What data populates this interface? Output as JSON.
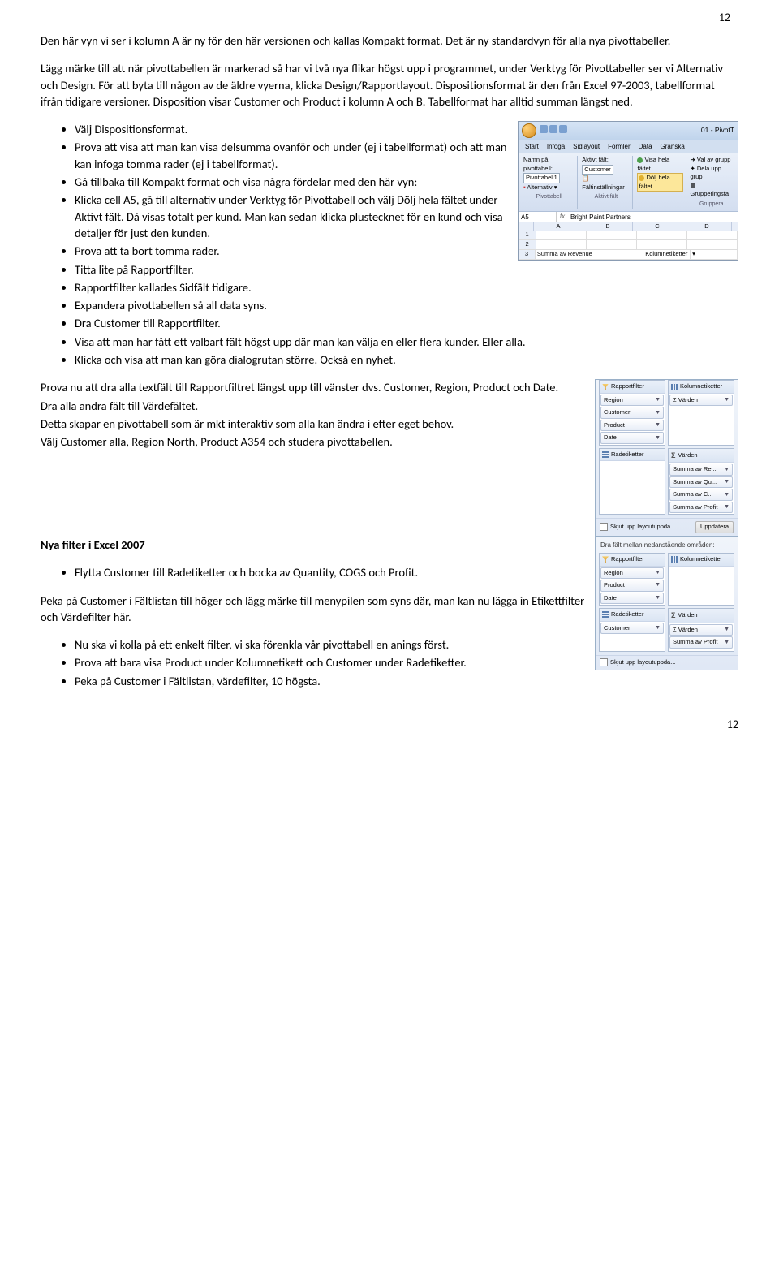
{
  "page": {
    "top": "12",
    "bottom": "12"
  },
  "para1": "Den här vyn vi ser i kolumn A är ny för den här versionen och kallas Kompakt format. Det är ny standardvyn för alla nya pivottabeller.",
  "para2": "Lägg märke till att när pivottabellen är markerad så har vi två nya flikar högst upp i programmet, under Verktyg för Pivottabeller ser vi Alternativ och Design. För att byta till någon av de äldre vyerna, klicka Design/Rapportlayout. Dispositionsformat är den från Excel 97-2003, tabellformat ifrån tidigare versioner. Disposition visar Customer och Product i kolumn A och B. Tabellformat har alltid summan längst ned.",
  "bullets1": {
    "i0": "Välj Dispositionsformat.",
    "i1": "Prova att visa att man kan visa delsumma ovanför och under (ej i tabellformat) och att man kan infoga tomma rader (ej i tabellformat).",
    "i2": "Gå tillbaka till Kompakt format och visa några fördelar med den här vyn:",
    "i3": "Klicka cell A5, gå till alternativ under Verktyg för Pivottabell och välj Dölj hela fältet under Aktivt fält. Då visas totalt per kund. Man kan sedan klicka plustecknet för en kund och visa detaljer för just den kunden.",
    "i4": " Prova att ta bort tomma rader.",
    "i5": "Titta lite på Rapportfilter.",
    "i6": "Rapportfilter kallades Sidfält tidigare.",
    "i7": "Expandera pivottabellen så all data syns.",
    "i8": "Dra Customer till Rapportfilter.",
    "i9": "Visa att man har fått ett valbart fält högst upp där man kan välja en eller flera kunder. Eller alla.",
    "i10": "Klicka och visa att man kan göra dialogrutan större. Också en nyhet."
  },
  "para3a": "Prova nu att dra alla textfält till Rapportfiltret längst upp till vänster dvs. Customer, Region, Product och Date.",
  "para3b": "Dra alla andra fält till Värdefältet.",
  "para3c": "Detta skapar en pivottabell som är mkt interaktiv som alla kan ändra i efter eget behov.",
  "para3d": "Välj Customer alla, Region North, Product A354 och studera pivottabellen.",
  "h2": "Nya filter i Excel 2007",
  "bullets2": {
    "i0": "Flytta Customer till Radetiketter och bocka av Quantity, COGS och Profit."
  },
  "para4": "Peka på Customer i Fältlistan till höger och lägg märke till menypilen som syns där, man kan nu lägga in Etikettfilter och Värdefilter här.",
  "bullets3": {
    "i0": "Nu ska vi kolla på ett enkelt filter, vi ska förenkla vår pivottabell en anings först.",
    "i1": "Prova att bara visa Product under Kolumnetikett och Customer under Radetiketter.",
    "i2": "Peka på Customer i Fältlistan, värdefilter, 10 högsta."
  },
  "ribbon": {
    "wintitle": "01 - PivotT",
    "tabs": {
      "t0": "Start",
      "t1": "Infoga",
      "t2": "Sidlayout",
      "t3": "Formler",
      "t4": "Data",
      "t5": "Granska"
    },
    "lbl_name": "Namn på pivottabell:",
    "val_name": "Pivottabell1",
    "lbl_active": "Aktivt fält:",
    "val_active": "Customer",
    "btn_alt": "Alternativ",
    "btn_field": "Fältinställningar",
    "opt_show": "Visa hela fältet",
    "opt_hide": "Dölj hela fältet",
    "opt_selgrp": "Val av grupp",
    "opt_ungrp": "Dela upp grup",
    "opt_grpfld": "Grupperingsfä",
    "grp1": "Pivottabell",
    "grp2": "Aktivt fält",
    "grp3": "Gruppera",
    "cellref": "A5",
    "formula": "Bright Paint Partners",
    "colA": "A",
    "colB": "B",
    "colC": "C",
    "colD": "D",
    "r3a": "Summa av Revenue",
    "r3b": "Kolumnetiketter"
  },
  "pane1": {
    "h_filter": "Rapportfilter",
    "h_cols": "Kolumnetiketter",
    "h_rows": "Radetiketter",
    "h_vals": "Värden",
    "p_region": "Region",
    "p_customer": "Customer",
    "p_product": "Product",
    "p_date": "Date",
    "v_sigma": "Σ Värden",
    "v_re": "Summa av Re...",
    "v_qu": "Summa av Qu...",
    "v_c": "Summa av C...",
    "v_pr": "Summa av Profit",
    "foot_chk": "Skjut upp layoutuppda...",
    "foot_btn": "Uppdatera"
  },
  "pane2": {
    "hdr": "Dra fält mellan nedanstående områden:",
    "h_filter": "Rapportfilter",
    "h_cols": "Kolumnetiketter",
    "h_rows": "Radetiketter",
    "h_vals": "Värden",
    "p_region": "Region",
    "p_product": "Product",
    "p_date": "Date",
    "p_customer": "Customer",
    "v_sigma": "Σ Värden",
    "v_pr": "Summa av Profit",
    "foot": "Skjut upp layoutuppda..."
  }
}
